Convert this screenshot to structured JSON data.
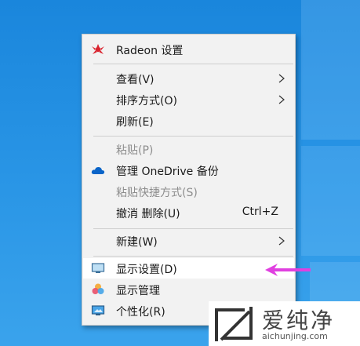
{
  "menu": {
    "items": [
      {
        "label": "Radeon 设置",
        "icon": "radeon-icon"
      },
      {
        "label": "查看(V)",
        "submenu": true
      },
      {
        "label": "排序方式(O)",
        "submenu": true
      },
      {
        "label": "刷新(E)"
      },
      {
        "label": "粘贴(P)",
        "disabled": true
      },
      {
        "label": "管理 OneDrive 备份",
        "icon": "onedrive-icon"
      },
      {
        "label": "粘贴快捷方式(S)",
        "disabled": true
      },
      {
        "label": "撤消 删除(U)",
        "shortcut": "Ctrl+Z"
      },
      {
        "label": "新建(W)",
        "submenu": true
      },
      {
        "label": "显示设置(D)",
        "icon": "display-settings-icon",
        "highlighted": true
      },
      {
        "label": "显示管理",
        "icon": "display-manager-icon"
      },
      {
        "label": "个性化(R)",
        "icon": "personalize-icon"
      }
    ]
  },
  "watermark": {
    "text": "爱纯净",
    "url": "aichunjing.com"
  },
  "colors": {
    "desktop": "#1a86dc",
    "menu_bg": "#f2f2f2",
    "highlight": "#ffffff",
    "annotation_arrow": "#e040e0",
    "radeon_red": "#d9232e",
    "onedrive_blue": "#0a64c8"
  }
}
